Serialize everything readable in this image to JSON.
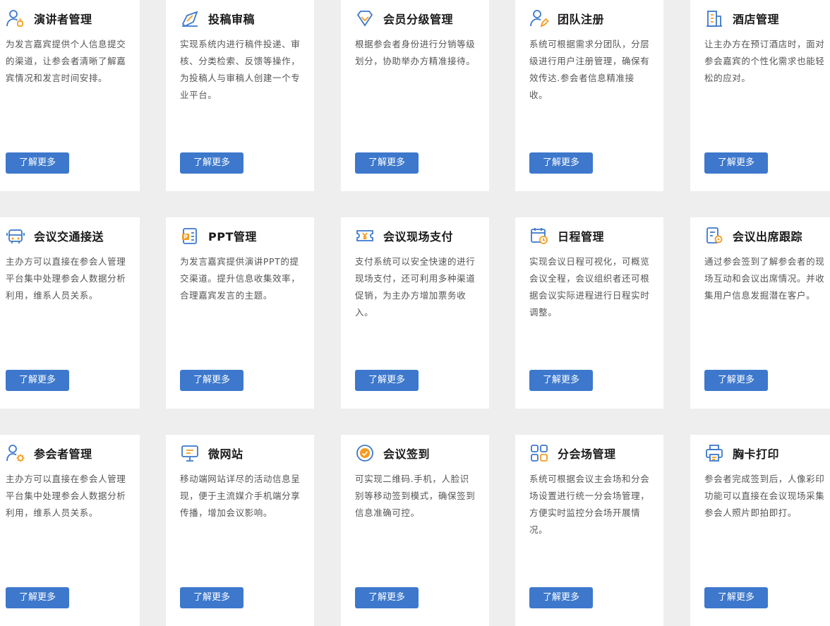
{
  "more_label": "了解更多",
  "colors": {
    "accent": "#3d78cc",
    "icon_blue": "#3d78cc",
    "icon_orange": "#f39c1f"
  },
  "cards": [
    {
      "title": "演讲者管理",
      "icon": "speaker-icon",
      "desc": "为发言嘉宾提供个人信息提交的渠道，让参会者清晰了解嘉宾情况和发言时间安排。"
    },
    {
      "title": "投稿审稿",
      "icon": "submission-icon",
      "desc": "实现系统内进行稿件投递、审核、分类检索、反馈等操作，为投稿人与审稿人创建一个专业平台。"
    },
    {
      "title": "会员分级管理",
      "icon": "diamond-icon",
      "desc": "根据参会者身份进行分销等级划分，协助举办方精准接待。"
    },
    {
      "title": "团队注册",
      "icon": "team-register-icon",
      "desc": "系统可根据需求分团队，分层级进行用户注册管理，确保有效传达.参会者信息精准接收。"
    },
    {
      "title": "酒店管理",
      "icon": "hotel-icon",
      "desc": "让主办方在预订酒店时，面对参会嘉宾的个性化需求也能轻松的应对。"
    },
    {
      "title": "会议交通接送",
      "icon": "bus-icon",
      "desc": "主办方可以直接在参会人管理平台集中处理参会人数据分析利用，维系人员关系。"
    },
    {
      "title": "PPT管理",
      "icon": "ppt-icon",
      "desc": "为发言嘉宾提供演讲PPT的提交渠道。提升信息收集效率，合理嘉宾发言的主题。"
    },
    {
      "title": "会议现场支付",
      "icon": "ticket-pay-icon",
      "desc": "支付系统可以安全快速的进行现场支付，还可利用多种渠道促销，为主办方增加票务收入。"
    },
    {
      "title": "日程管理",
      "icon": "calendar-icon",
      "desc": "实现会议日程可视化，可概览会议全程，会议组织者还可根据会议实际进程进行日程实时调整。"
    },
    {
      "title": "会议出席跟踪",
      "icon": "attendance-icon",
      "desc": "通过参会签到了解参会者的现场互动和会议出席情况。并收集用户信息发掘潜在客户。"
    },
    {
      "title": "参会者管理",
      "icon": "attendee-settings-icon",
      "desc": "主办方可以直接在参会人管理平台集中处理参会人数据分析利用，维系人员关系。"
    },
    {
      "title": "微网站",
      "icon": "monitor-icon",
      "desc": "移动端网站详尽的活动信息呈现，便于主流媒介手机端分享传播，增加会议影响。"
    },
    {
      "title": "会议签到",
      "icon": "signin-icon",
      "desc": "可实现二维码.手机，人脸识别等移动签到模式，确保签到信息准确可控。"
    },
    {
      "title": "分会场管理",
      "icon": "grid-icon",
      "desc": "系统可根据会议主会场和分会场设置进行统一分会场管理，方便实时监控分会场开展情况。"
    },
    {
      "title": "胸卡打印",
      "icon": "printer-icon",
      "desc": "参会者完成签到后，人像彩印功能可以直接在会议现场采集参会人照片即拍即打。"
    }
  ]
}
